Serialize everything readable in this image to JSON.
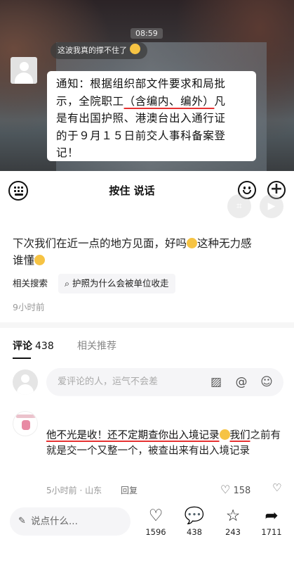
{
  "media": {
    "time": "08:59",
    "chat_line": "这波我真的撑不住了",
    "notice_lines": [
      "通知：根据组织部文件要求和局批",
      "示，全院职工（含编内、编外）凡",
      "是有出国护照、港澳台出入通行证",
      "的于９月１５日前交人事科备案登",
      "记！"
    ]
  },
  "voice_bar": {
    "hold_label": "按住 说话"
  },
  "post": {
    "caption_a": "下次我们在近一点的地方见面，好吗",
    "caption_b": "这种无力感",
    "caption_c": "谁懂",
    "related_label": "相关搜索",
    "related_query": "护照为什么会被单位收走",
    "time_ago": "9小时前"
  },
  "tabs": {
    "comments_label": "评论",
    "comments_count": "438",
    "related_label": "相关推荐"
  },
  "comment_input": {
    "placeholder": "爱评论的人，运气不会差"
  },
  "comment": {
    "text_highlight_a": "他不光是收！还不定期查你出入境记录",
    "text_highlight_b": "我们",
    "text_rest": "之前有就是交一个又整一个，被查出来有出入境记录",
    "meta": "5小时前 · 山东",
    "reply_label": "回复",
    "likes": "158"
  },
  "bottom_bar": {
    "say_placeholder": "说点什么...",
    "likes": "1596",
    "comments": "438",
    "favorites": "243",
    "shares": "1711"
  },
  "colors": {
    "underline_red": "#e63232",
    "emoji_yellow": "#f6c343"
  }
}
